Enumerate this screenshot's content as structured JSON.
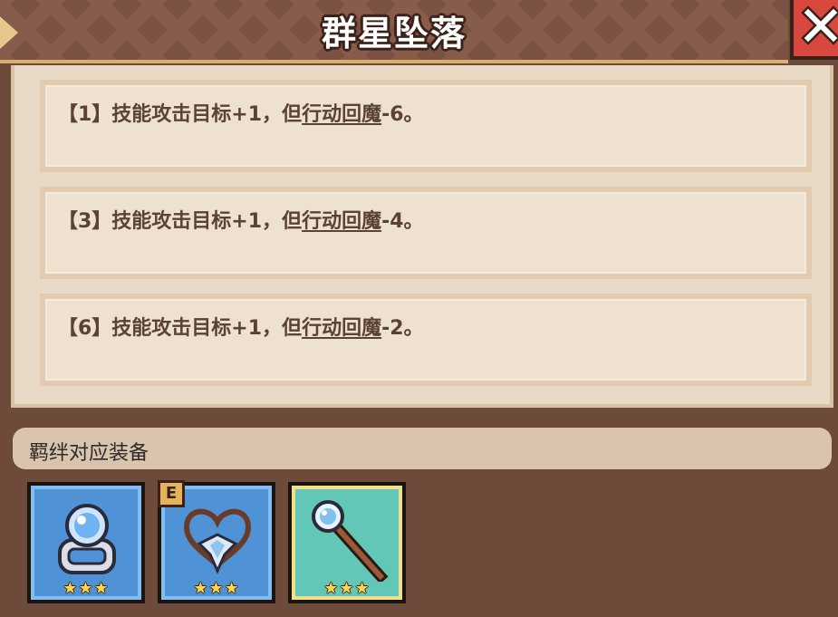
{
  "title": "群星坠落",
  "effects": [
    {
      "prefix": "【1】技能攻击目标+1，但",
      "keyword": "行动回魔",
      "suffix": "-6。"
    },
    {
      "prefix": "【3】技能攻击目标+1，但",
      "keyword": "行动回魔",
      "suffix": "-4。"
    },
    {
      "prefix": "【6】技能攻击目标+1，但",
      "keyword": "行动回魔",
      "suffix": "-2。"
    }
  ],
  "equipment_section": {
    "label": "羁绊对应装备",
    "items": [
      {
        "icon": "ring-icon",
        "stars": "★★★",
        "frame_color": "#4f93d6"
      },
      {
        "icon": "heart-necklace-icon",
        "stars": "★★★",
        "badge": "E",
        "frame_color": "#4f93d6"
      },
      {
        "icon": "staff-icon",
        "stars": "★★★",
        "frame_color": "#62c7b6"
      }
    ]
  }
}
